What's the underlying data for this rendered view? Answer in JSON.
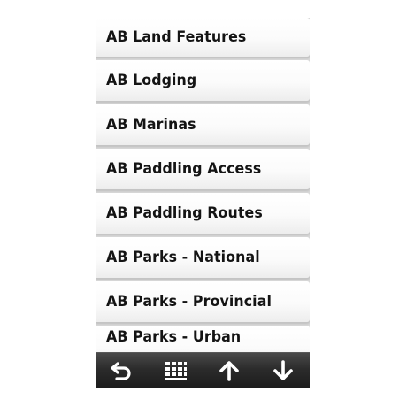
{
  "list": {
    "items": [
      {
        "label": "AB Land Features"
      },
      {
        "label": "AB Lodging"
      },
      {
        "label": "AB Marinas"
      },
      {
        "label": "AB Paddling Access"
      },
      {
        "label": "AB Paddling Routes"
      },
      {
        "label": "AB Parks - National"
      },
      {
        "label": "AB Parks - Provincial"
      },
      {
        "label": "AB Parks - Urban"
      }
    ]
  },
  "toolbar": {
    "buttons": [
      {
        "icon": "back-arrow-icon"
      },
      {
        "icon": "list-grid-icon"
      },
      {
        "icon": "arrow-up-icon"
      },
      {
        "icon": "arrow-down-icon"
      }
    ]
  },
  "colors": {
    "toolbar_bg": "#2c2c2c",
    "icon_color": "#ffffff",
    "item_text": "#141414"
  }
}
